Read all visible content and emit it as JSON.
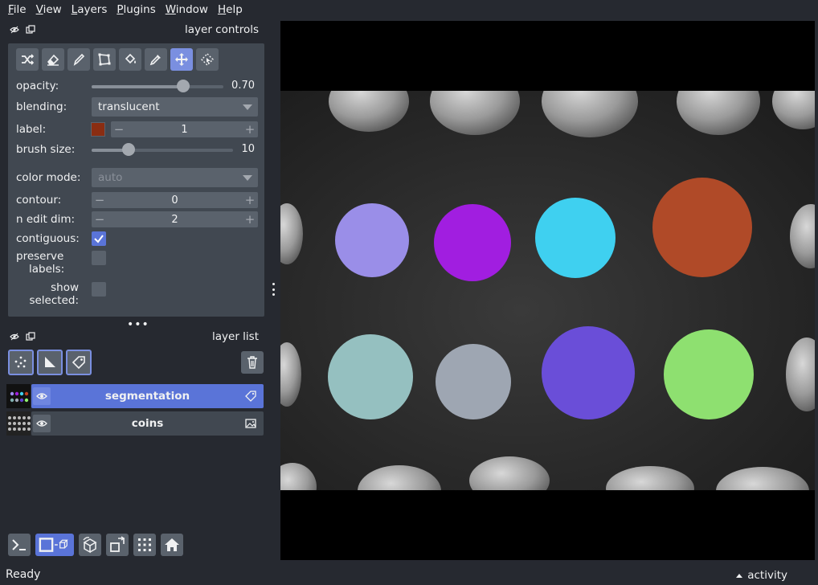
{
  "menu": {
    "items": [
      {
        "label": "File",
        "u": "F",
        "rest": "ile"
      },
      {
        "label": "View",
        "u": "V",
        "rest": "iew"
      },
      {
        "label": "Layers",
        "u": "L",
        "rest": "ayers"
      },
      {
        "label": "Plugins",
        "u": "P",
        "rest": "lugins"
      },
      {
        "label": "Window",
        "u": "W",
        "rest": "indow"
      },
      {
        "label": "Help",
        "u": "H",
        "rest": "elp"
      }
    ]
  },
  "layer_controls": {
    "title": "layer controls",
    "tools": [
      "shuffle-icon",
      "eraser-icon",
      "paintbrush-icon",
      "polygon-icon",
      "fill-bucket-icon",
      "eyedropper-icon",
      "move-icon",
      "transform-icon"
    ],
    "active_tool": "move-icon",
    "opacity": {
      "label": "opacity:",
      "value": "0.70",
      "fraction": 0.7
    },
    "blending": {
      "label": "blending:",
      "value": "translucent"
    },
    "label": {
      "label": "label:",
      "value": "1",
      "color": "#8a2d12",
      "minus": "−",
      "plus": "+"
    },
    "brush_size": {
      "label": "brush size:",
      "value": "10",
      "fraction": 0.22
    },
    "color_mode": {
      "label": "color mode:",
      "value": "auto"
    },
    "contour": {
      "label": "contour:",
      "value": "0",
      "minus": "−",
      "plus": "+"
    },
    "n_edit_dim": {
      "label": "n edit dim:",
      "value": "2",
      "minus": "−",
      "plus": "+"
    },
    "contiguous": {
      "label": "contiguous:",
      "checked": true
    },
    "preserve_labels": {
      "label_line1": "preserve",
      "label_line2": "labels:",
      "checked": false
    },
    "show_selected": {
      "label_line1": "show",
      "label_line2": "selected:",
      "checked": false
    },
    "more": "•••"
  },
  "layer_list": {
    "title": "layer list",
    "new_layer_buttons": [
      "points-icon",
      "shapes-icon",
      "labels-icon"
    ],
    "layers": [
      {
        "name": "segmentation",
        "type_icon": "label-tag-icon",
        "selected": true
      },
      {
        "name": "coins",
        "type_icon": "image-icon",
        "selected": false
      }
    ]
  },
  "bottom_toolbar": [
    "console-icon",
    "ndisplay-toggle-icon",
    "roll-dims-icon",
    "transpose-icon",
    "grid-icon",
    "home-icon"
  ],
  "status": {
    "text": "Ready",
    "activity": "activity"
  },
  "colors": {
    "accent": "#5a74d8",
    "panel": "#414851",
    "background": "#262930",
    "button": "#5a626c"
  }
}
